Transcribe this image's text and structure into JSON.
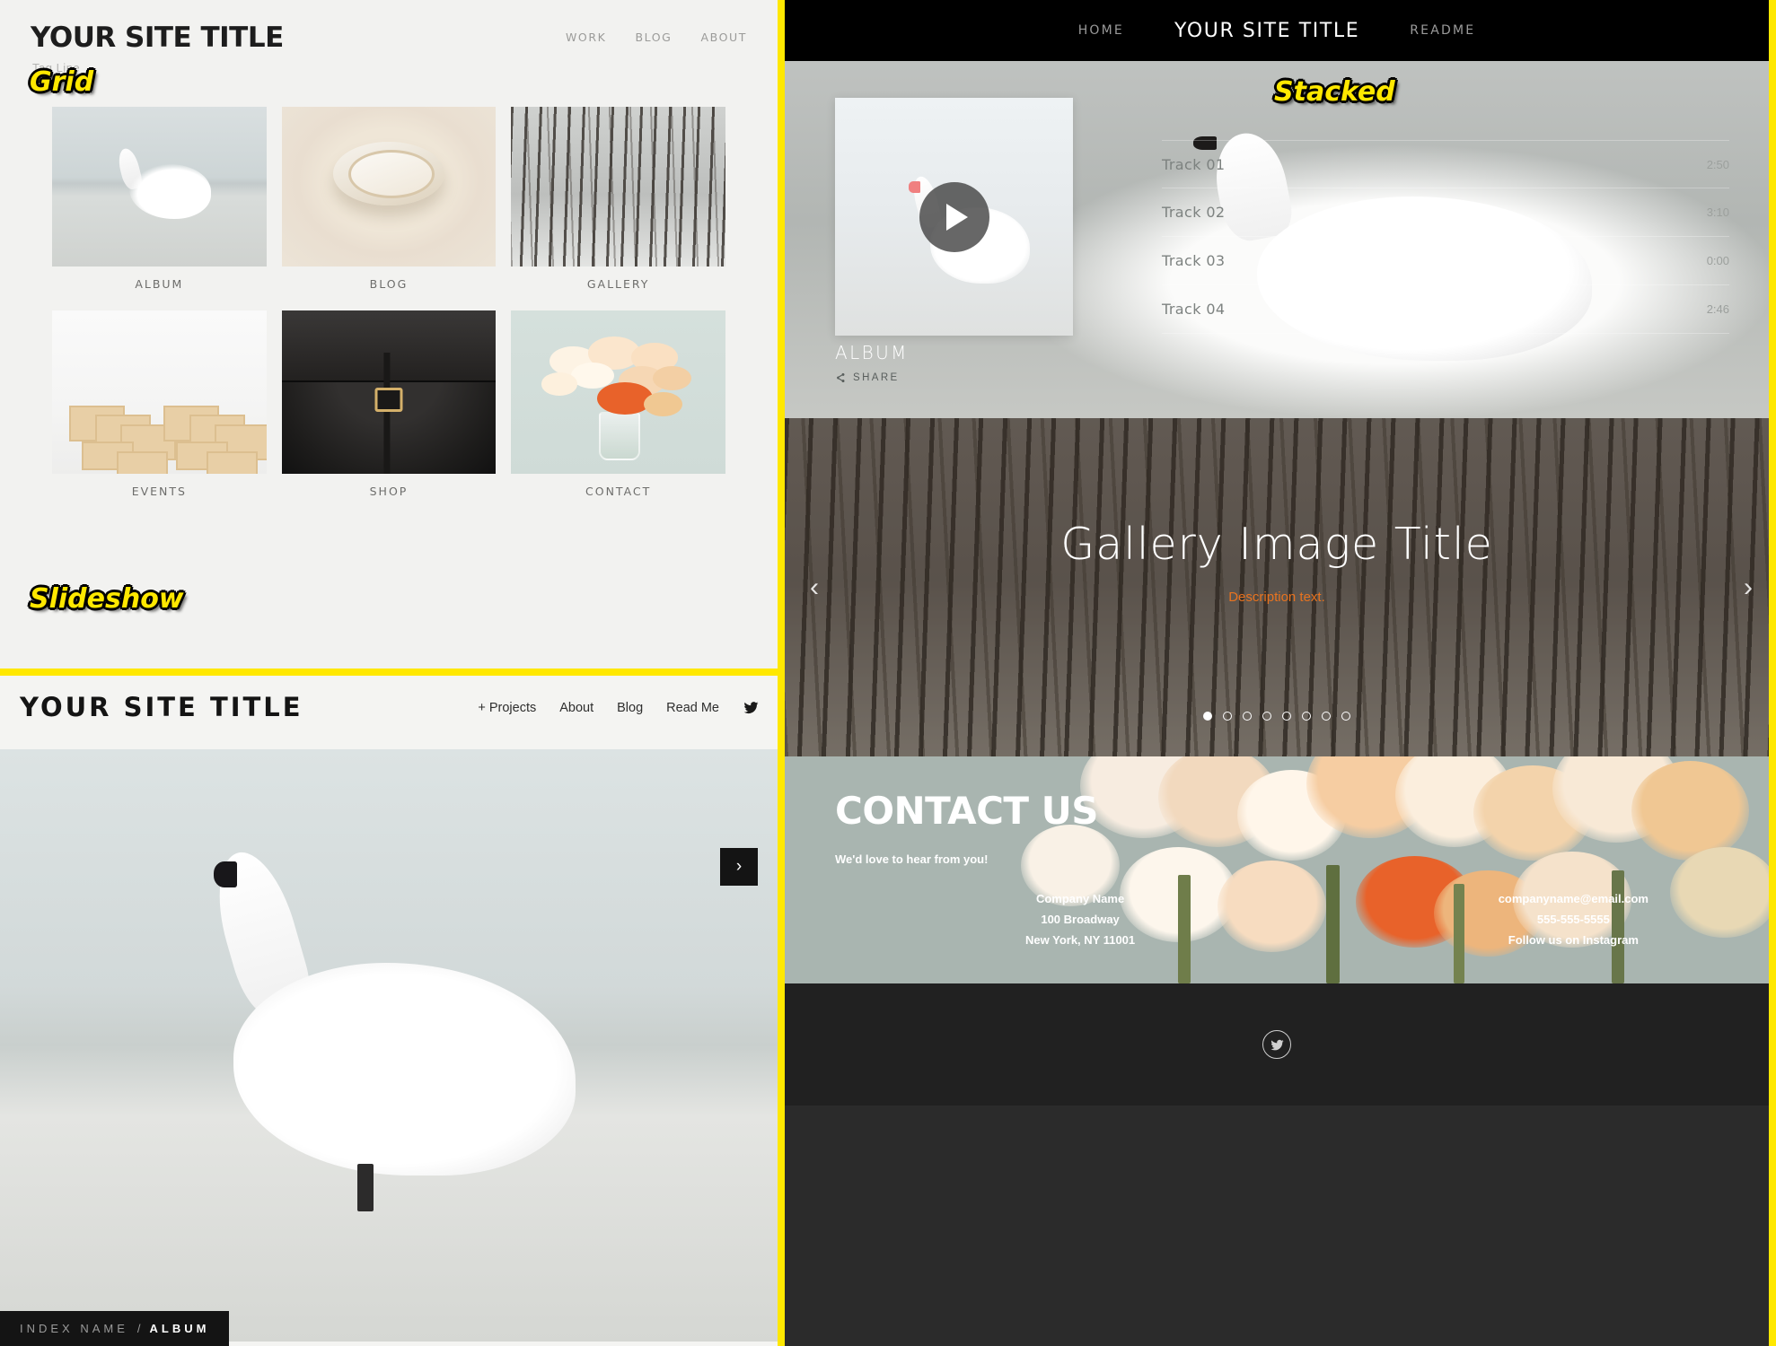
{
  "panels": {
    "grid": {
      "badge": "Grid",
      "site_title": "YOUR SITE TITLE",
      "tagline": "Tag Line",
      "nav": [
        "WORK",
        "BLOG",
        "ABOUT"
      ],
      "cells": [
        {
          "label": "ALBUM",
          "art": "swan-lake"
        },
        {
          "label": "BLOG",
          "art": "bowl"
        },
        {
          "label": "GALLERY",
          "art": "forest"
        },
        {
          "label": "EVENTS",
          "art": "desks"
        },
        {
          "label": "SHOP",
          "art": "bag"
        },
        {
          "label": "CONTACT",
          "art": "flowers"
        }
      ]
    },
    "stacked": {
      "badge": "Stacked",
      "nav": {
        "left": "HOME",
        "brand": "YOUR SITE TITLE",
        "right": "README"
      },
      "album": {
        "title": "ALBUM",
        "share_label": "SHARE",
        "play_icon": "play-icon",
        "tracks": [
          {
            "name": "Track 01",
            "duration": "2:50"
          },
          {
            "name": "Track 02",
            "duration": "3:10"
          },
          {
            "name": "Track 03",
            "duration": "0:00"
          },
          {
            "name": "Track 04",
            "duration": "2:46"
          }
        ]
      },
      "gallery": {
        "title": "Gallery Image Title",
        "description": "Description text.",
        "prev_icon": "chevron-left-icon",
        "next_icon": "chevron-right-icon",
        "dots_total": 8,
        "dots_active": 1,
        "description_color": "#e8731f"
      },
      "contact": {
        "title": "CONTACT US",
        "subtitle": "We'd love to hear from you!",
        "left_column": [
          "Company Name",
          "100 Broadway",
          "New York, NY 11001"
        ],
        "right_column": [
          "companyname@email.com",
          "555-555-5555",
          "Follow us on Instagram"
        ]
      },
      "footer": {
        "social_icon": "twitter-icon"
      }
    },
    "slideshow": {
      "badge": "Slideshow",
      "site_title": "YOUR SITE TITLE",
      "nav": [
        "+ Projects",
        "About",
        "Blog",
        "Read Me"
      ],
      "nav_social_icon": "twitter-icon",
      "next_icon": "chevron-right-icon",
      "index_name": "INDEX NAME",
      "index_separator": "/",
      "index_current": "ALBUM"
    }
  },
  "colors": {
    "divider": "#ffe800",
    "badge_text": "#ffe800",
    "accent_orange": "#e8731f",
    "dark": "#141414"
  }
}
